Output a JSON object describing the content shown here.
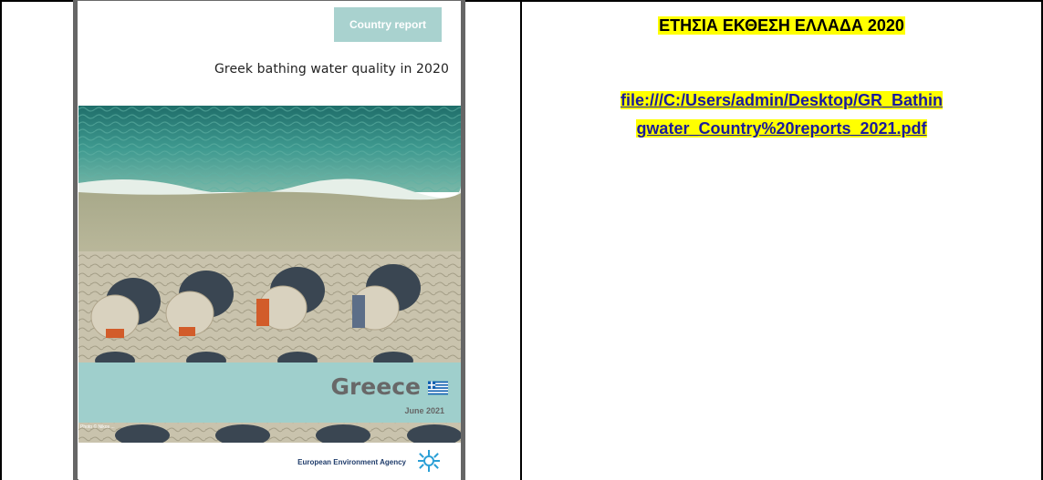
{
  "cover": {
    "badge": "Country report",
    "title": "Greek bathing water quality in 2020",
    "country": "Greece",
    "date": "June 2021",
    "credit": "Photo © Nikos ...",
    "agency": "European Environment Agency",
    "colors": {
      "teal": "#9fcfcc",
      "badge": "#a9d2cf"
    }
  },
  "right_cell": {
    "title": "ΕΤΗΣΙΑ ΕΚΘΕΣΗ ΕΛΛΑΔΑ 2020",
    "link_line1": "file:///C:/Users/admin/Desktop/GR_Bathin",
    "link_line2": "gwater_Country%20reports_2021.pdf",
    "highlight": "#ffff00"
  }
}
